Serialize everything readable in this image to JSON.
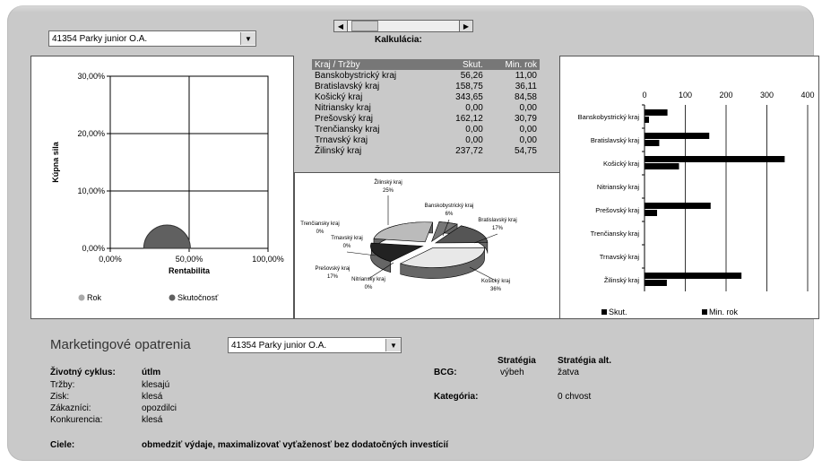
{
  "top": {
    "product_select": "41354 Parky junior O.A.",
    "calc_label": "Kalkulácia:"
  },
  "bubble_chart": {
    "ylabel": "Kúpna sila",
    "xlabel": "Rentabilita",
    "y_ticks": [
      "30,00%",
      "20,00%",
      "10,00%",
      "0,00%"
    ],
    "x_ticks": [
      "0,00%",
      "50,00%",
      "100,00%"
    ],
    "legend": [
      "Rok",
      "Skutočnosť"
    ],
    "colors": {
      "rok": "#aaaaaa",
      "skutocnost": "#606060"
    }
  },
  "table": {
    "headers": [
      "Kraj / Tržby",
      "Skut.",
      "Min. rok"
    ],
    "rows": [
      {
        "kraj": "Banskobystrický kraj",
        "skut": "56,26",
        "min": "11,00"
      },
      {
        "kraj": "Bratislavský kraj",
        "skut": "158,75",
        "min": "36,11"
      },
      {
        "kraj": "Košický kraj",
        "skut": "343,65",
        "min": "84,58"
      },
      {
        "kraj": "Nitriansky kraj",
        "skut": "0,00",
        "min": "0,00"
      },
      {
        "kraj": "Prešovský kraj",
        "skut": "162,12",
        "min": "30,79"
      },
      {
        "kraj": "Trenčiansky kraj",
        "skut": "0,00",
        "min": "0,00"
      },
      {
        "kraj": "Trnavský kraj",
        "skut": "0,00",
        "min": "0,00"
      },
      {
        "kraj": "Žilinský kraj",
        "skut": "237,72",
        "min": "54,75"
      }
    ]
  },
  "pie_labels": [
    {
      "name": "Žilinský kraj",
      "pct": "25%"
    },
    {
      "name": "Banskobystrický kraj",
      "pct": "6%"
    },
    {
      "name": "Bratislavský kraj",
      "pct": "17%"
    },
    {
      "name": "Košický kraj",
      "pct": "36%"
    },
    {
      "name": "Nitriansky kraj",
      "pct": "0%"
    },
    {
      "name": "Prešovský kraj",
      "pct": "17%"
    },
    {
      "name": "Trnavský kraj",
      "pct": "0%"
    },
    {
      "name": "Trenčiansky kraj",
      "pct": "0%"
    }
  ],
  "chart_data": [
    {
      "type": "pie",
      "categories": [
        "Banskobystrický kraj",
        "Bratislavský kraj",
        "Košický kraj",
        "Nitriansky kraj",
        "Prešovský kraj",
        "Trenčiansky kraj",
        "Trnavský kraj",
        "Žilinský kraj"
      ],
      "values": [
        56.26,
        158.75,
        343.65,
        0,
        162.12,
        0,
        0,
        237.72
      ],
      "labels_pct": [
        "6%",
        "17%",
        "36%",
        "0%",
        "17%",
        "0%",
        "0%",
        "25%"
      ]
    },
    {
      "type": "bar",
      "orientation": "horizontal",
      "categories": [
        "Banskobystrický kraj",
        "Bratislavský kraj",
        "Košický kraj",
        "Nitriansky kraj",
        "Prešovský kraj",
        "Trenčiansky kraj",
        "Trnavský kraj",
        "Žilinský kraj"
      ],
      "series": [
        {
          "name": "Skut.",
          "values": [
            56.26,
            158.75,
            343.65,
            0,
            162.12,
            0,
            0,
            237.72
          ]
        },
        {
          "name": "Min. rok",
          "values": [
            11.0,
            36.11,
            84.58,
            0,
            30.79,
            0,
            0,
            54.75
          ]
        }
      ],
      "x_ticks": [
        "0",
        "100",
        "200",
        "300",
        "400"
      ],
      "xlim": [
        0,
        400
      ],
      "legend_position": "bottom"
    }
  ],
  "marketing": {
    "title": "Marketingové opatrenia",
    "select": "41354 Parky junior O.A.",
    "lifecycle_label": "Životný cyklus:",
    "lifecycle_value": "útlm",
    "rows": [
      {
        "label": "Tržby:",
        "value": "klesajú"
      },
      {
        "label": "Zisk:",
        "value": "klesá"
      },
      {
        "label": "Zákazníci:",
        "value": "opozdilci"
      },
      {
        "label": "Konkurencia:",
        "value": "klesá"
      }
    ],
    "strategy_header": "Stratégia",
    "strategy_alt_header": "Stratégia alt.",
    "bcg_label": "BCG:",
    "bcg_strategy": "výbeh",
    "bcg_strategy_alt": "žatva",
    "category_label": "Kategória:",
    "category_value": "0 chvost",
    "goals_label": "Ciele:",
    "goals_value": "obmedziť výdaje, maximalizovať vyťaženosť bez dodatočných investícií"
  }
}
